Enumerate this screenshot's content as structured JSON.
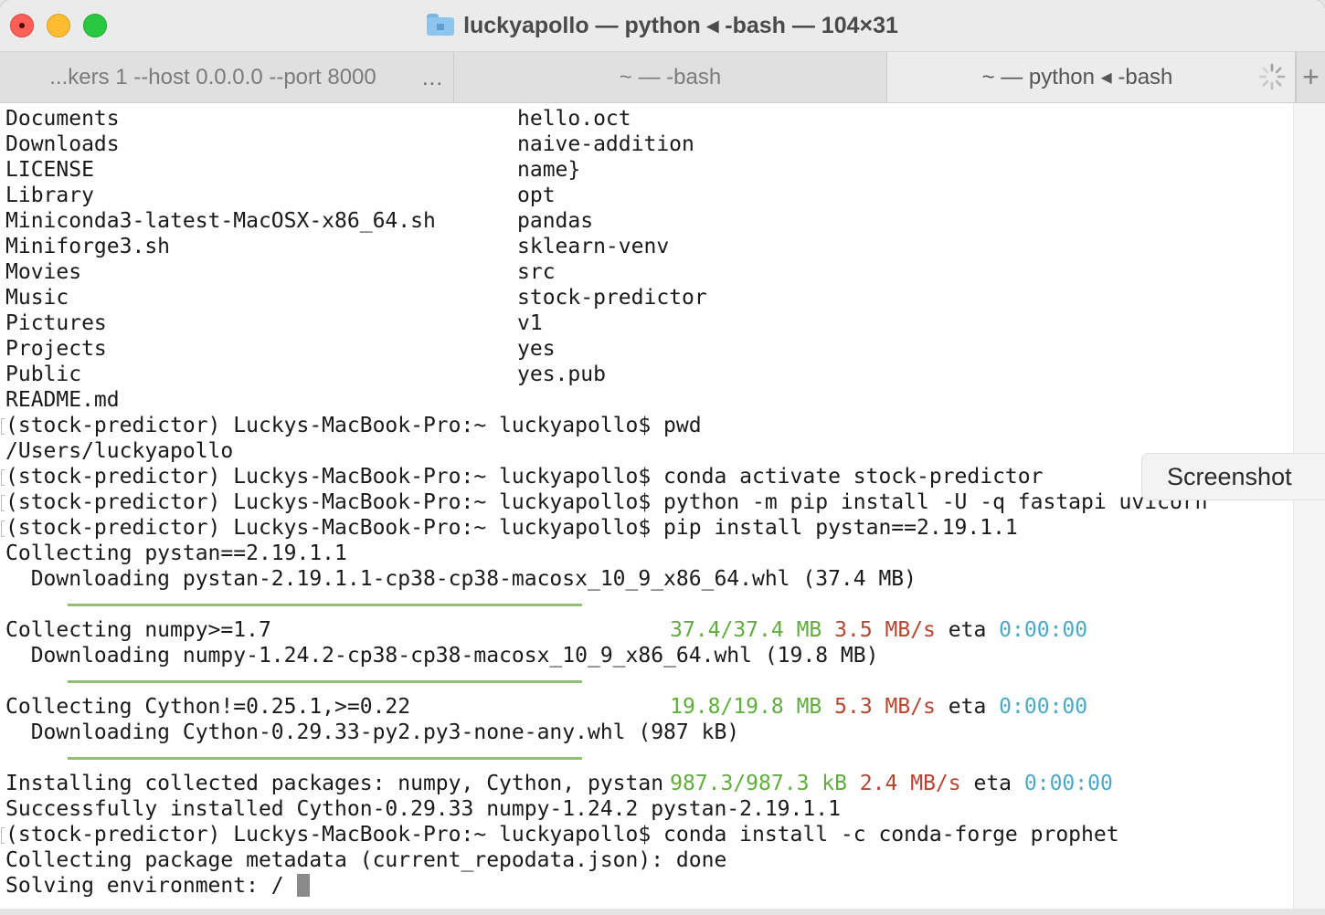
{
  "window": {
    "title": "luckyapollo — python ◂ -bash — 104×31"
  },
  "tabs": [
    {
      "label": "...kers 1 --host 0.0.0.0 --port 8000",
      "active": false
    },
    {
      "label": "~ — -bash",
      "active": false
    },
    {
      "label": "~ — python ◂ -bash",
      "active": true
    }
  ],
  "tab_overflow_label": "...",
  "new_tab_label": "+",
  "tooltip": "Screenshot",
  "terminal": {
    "ls_left": [
      "Documents",
      "Downloads",
      "LICENSE",
      "Library",
      "Miniconda3-latest-MacOSX-x86_64.sh",
      "Miniforge3.sh",
      "Movies",
      "Music",
      "Pictures",
      "Projects",
      "Public",
      "README.md"
    ],
    "ls_right": [
      "hello.oct",
      "naive-addition",
      "name}",
      "opt",
      "pandas",
      "sklearn-venv",
      "src",
      "stock-predictor",
      "v1",
      "yes",
      "yes.pub"
    ],
    "lines": [
      "(stock-predictor) Luckys-MacBook-Pro:~ luckyapollo$ pwd",
      "/Users/luckyapollo",
      "(stock-predictor) Luckys-MacBook-Pro:~ luckyapollo$ conda activate stock-predictor",
      "(stock-predictor) Luckys-MacBook-Pro:~ luckyapollo$ python -m pip install -U -q fastapi uvicorn",
      "(stock-predictor) Luckys-MacBook-Pro:~ luckyapollo$ pip install pystan==2.19.1.1",
      "Collecting pystan==2.19.1.1",
      "  Downloading pystan-2.19.1.1-cp38-cp38-macosx_10_9_x86_64.whl (37.4 MB)",
      "Collecting numpy>=1.7",
      "  Downloading numpy-1.24.2-cp38-cp38-macosx_10_9_x86_64.whl (19.8 MB)",
      "Collecting Cython!=0.25.1,>=0.22",
      "  Downloading Cython-0.29.33-py2.py3-none-any.whl (987 kB)",
      "Installing collected packages: numpy, Cython, pystan",
      "Successfully installed Cython-0.29.33 numpy-1.24.2 pystan-2.19.1.1",
      "(stock-predictor) Luckys-MacBook-Pro:~ luckyapollo$ conda install -c conda-forge prophet",
      "Collecting package metadata (current_repodata.json): done",
      "Solving environment: / "
    ],
    "progress": [
      {
        "done": "37.4/37.4 MB",
        "rate": "3.5 MB/s",
        "eta_label": "eta",
        "eta": "0:00:00",
        "fraction": 1.0
      },
      {
        "done": "19.8/19.8 MB",
        "rate": "5.3 MB/s",
        "eta_label": "eta",
        "eta": "0:00:00",
        "fraction": 1.0
      },
      {
        "done": "987.3/987.3 kB",
        "rate": "2.4 MB/s",
        "eta_label": "eta",
        "eta": "0:00:00",
        "fraction": 1.0
      }
    ]
  },
  "colors": {
    "progress_bar": "#8fc06f",
    "done": "#5fae3c",
    "rate": "#b8452f",
    "eta": "#4aa9c4"
  }
}
